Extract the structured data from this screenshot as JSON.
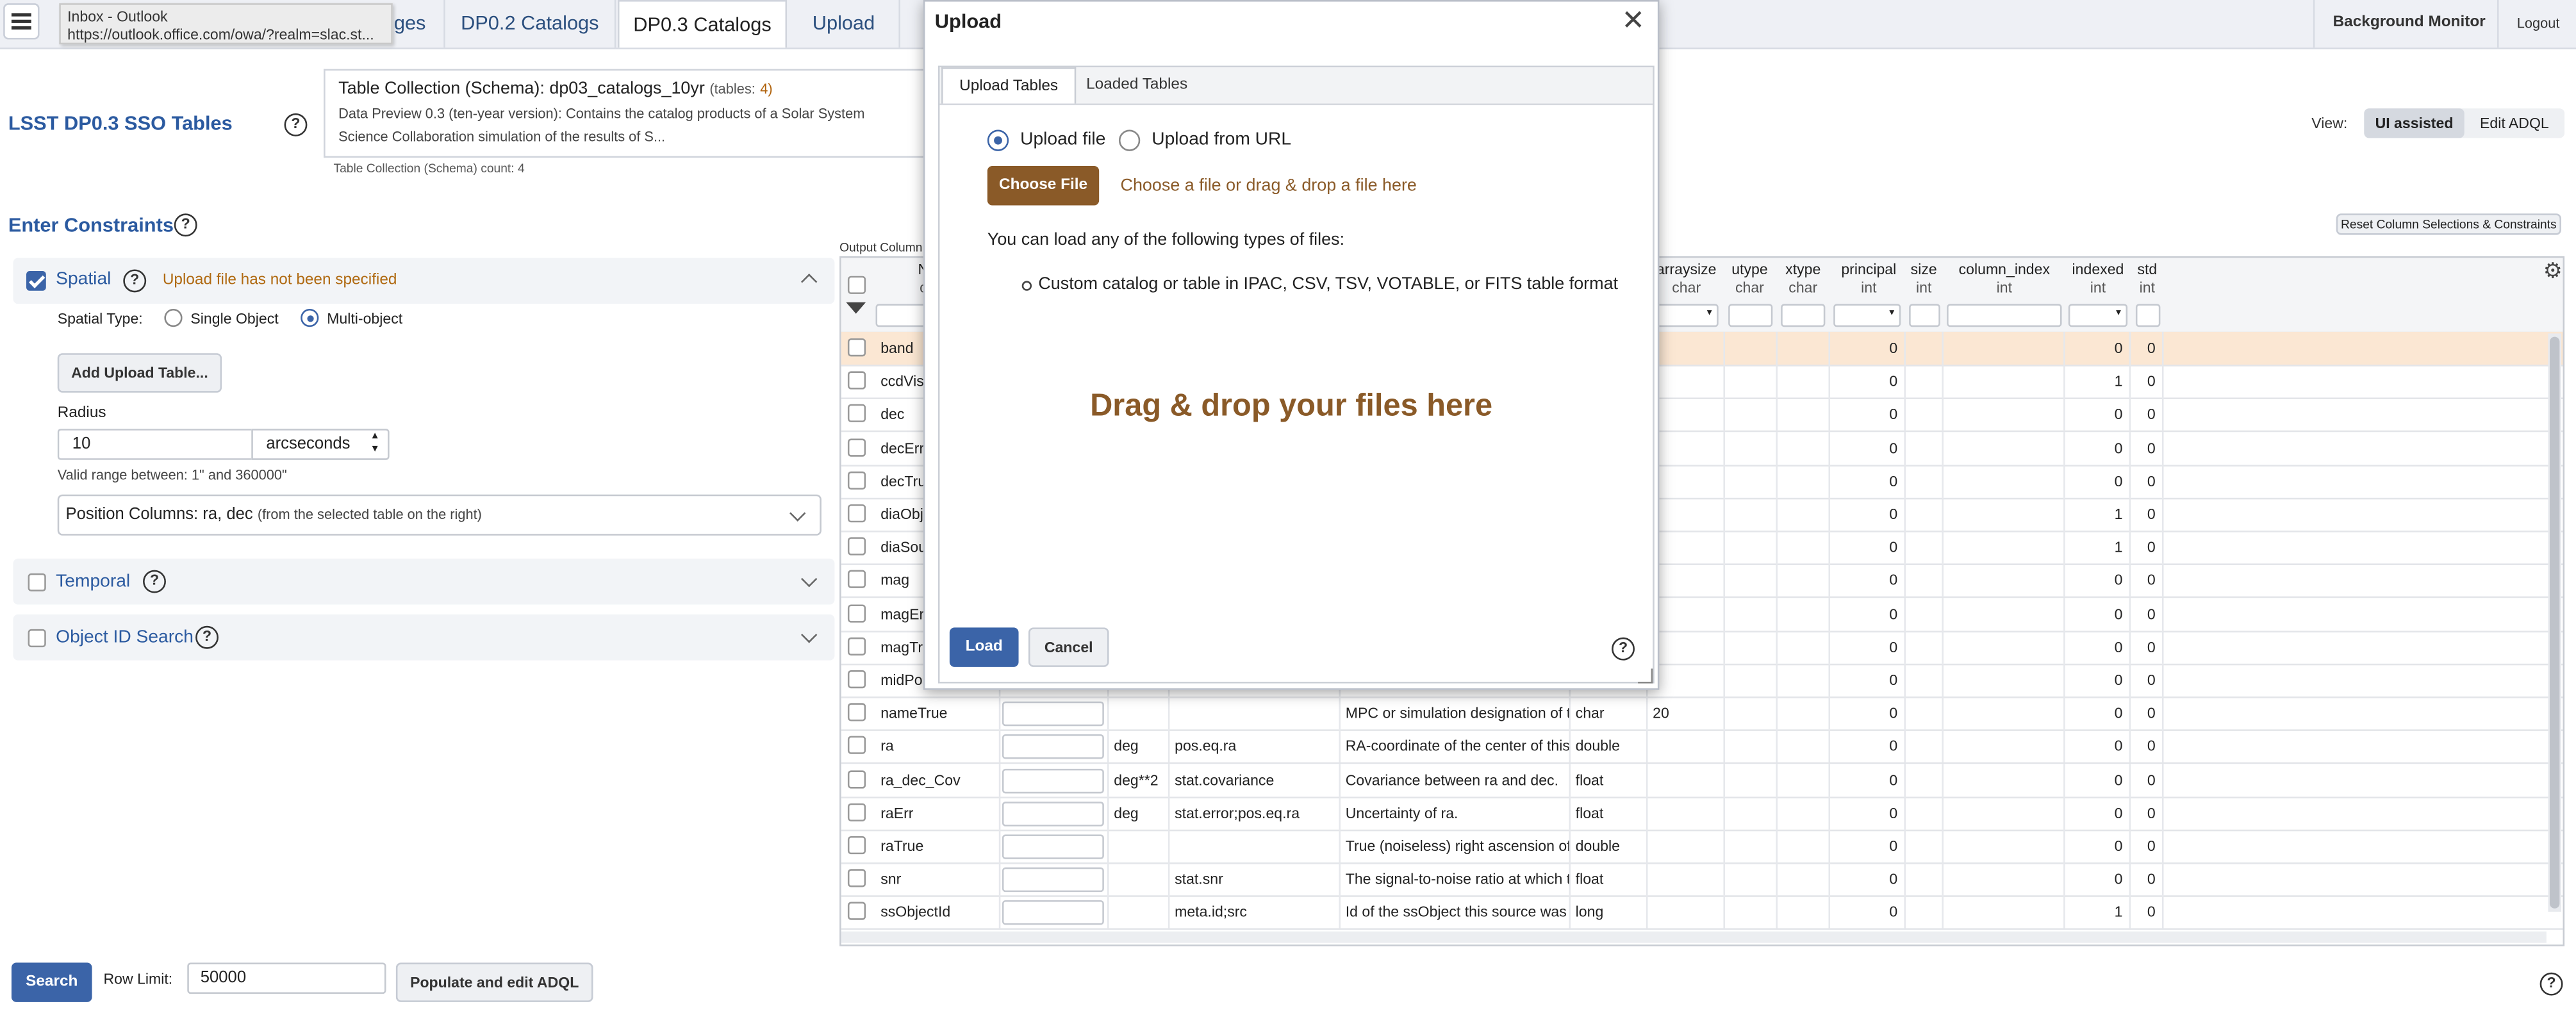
{
  "topbar": {
    "tabs": [
      {
        "label": "ges"
      },
      {
        "label": "DP0.2 Catalogs"
      },
      {
        "label": "DP0.3 Catalogs"
      },
      {
        "label": "Upload"
      }
    ],
    "background_monitor": "Background Monitor",
    "logout": "Logout",
    "tooltip": {
      "title": "Inbox - Outlook",
      "url": "https://outlook.office.com/owa/?realm=slac.st..."
    }
  },
  "header": {
    "title": "LSST DP0.3 SSO Tables",
    "collection_label": "Table Collection (Schema):",
    "collection_value": "dp03_catalogs_10yr",
    "tables_label": "(tables:",
    "tables_count": "4)",
    "description_1": "Data Preview 0.3 (ten-year version): Contains the catalog products of a Solar System",
    "description_2": "Science Collaboration simulation of the results of S...",
    "collection_count": "Table Collection (Schema) count: 4",
    "view_label": "View:",
    "view_ui": "UI assisted",
    "view_adql": "Edit ADQL"
  },
  "constraints": {
    "title": "Enter Constraints",
    "reset": "Reset Column Selections & Constraints",
    "output_columns": "Output Column",
    "spatial": {
      "label": "Spatial",
      "warning": "Upload file has not been specified",
      "type_label": "Spatial Type:",
      "single": "Single Object",
      "multi": "Multi-object",
      "add_upload": "Add Upload Table...",
      "radius_label": "Radius",
      "radius_value": "10",
      "radius_unit": "arcseconds",
      "valid_range": "Valid range between: 1\" and 360000\"",
      "position_label": "Position Columns:",
      "position_value": "ra, dec",
      "position_note": "(from the selected table on the right)"
    },
    "temporal": "Temporal",
    "object_id": "Object ID Search"
  },
  "bottom": {
    "search": "Search",
    "row_limit_label": "Row Limit:",
    "row_limit_value": "50000",
    "populate": "Populate and edit ADQL"
  },
  "grid": {
    "headers": [
      {
        "name": "N",
        "type": "c"
      },
      {
        "name": "arraysize",
        "type": "char"
      },
      {
        "name": "utype",
        "type": "char"
      },
      {
        "name": "xtype",
        "type": "char"
      },
      {
        "name": "principal",
        "type": "int"
      },
      {
        "name": "size",
        "type": "int"
      },
      {
        "name": "column_index",
        "type": "int"
      },
      {
        "name": "indexed",
        "type": "int"
      },
      {
        "name": "std",
        "type": "int"
      }
    ],
    "rows": [
      {
        "name": "band",
        "unit": "",
        "ucd": "",
        "desc": "",
        "dtype": "",
        "arraysize": "",
        "principal": "0",
        "indexed": "0",
        "std": "0"
      },
      {
        "name": "ccdVisit",
        "unit": "",
        "ucd": "",
        "desc": "",
        "dtype": "",
        "arraysize": "",
        "principal": "0",
        "indexed": "1",
        "std": "0"
      },
      {
        "name": "dec",
        "unit": "",
        "ucd": "",
        "desc": "",
        "dtype": "",
        "arraysize": "",
        "principal": "0",
        "indexed": "0",
        "std": "0"
      },
      {
        "name": "decErr",
        "unit": "",
        "ucd": "",
        "desc": "",
        "dtype": "",
        "arraysize": "",
        "principal": "0",
        "indexed": "0",
        "std": "0"
      },
      {
        "name": "decTrue",
        "unit": "",
        "ucd": "",
        "desc": "",
        "dtype": "",
        "arraysize": "",
        "principal": "0",
        "indexed": "0",
        "std": "0"
      },
      {
        "name": "diaObje",
        "unit": "",
        "ucd": "",
        "desc": "",
        "dtype": "",
        "arraysize": "",
        "principal": "0",
        "indexed": "1",
        "std": "0"
      },
      {
        "name": "diaSour",
        "unit": "",
        "ucd": "",
        "desc": "",
        "dtype": "",
        "arraysize": "",
        "principal": "0",
        "indexed": "1",
        "std": "0"
      },
      {
        "name": "mag",
        "unit": "",
        "ucd": "",
        "desc": "",
        "dtype": "",
        "arraysize": "",
        "principal": "0",
        "indexed": "0",
        "std": "0"
      },
      {
        "name": "magErr",
        "unit": "",
        "ucd": "",
        "desc": "",
        "dtype": "",
        "arraysize": "",
        "principal": "0",
        "indexed": "0",
        "std": "0"
      },
      {
        "name": "magTru",
        "unit": "",
        "ucd": "",
        "desc": "",
        "dtype": "",
        "arraysize": "",
        "principal": "0",
        "indexed": "0",
        "std": "0"
      },
      {
        "name": "midPoi",
        "unit": "",
        "ucd": "",
        "desc": "",
        "dtype": "",
        "arraysize": "",
        "principal": "0",
        "indexed": "0",
        "std": "0"
      },
      {
        "name": "nameTrue",
        "unit": "",
        "ucd": "",
        "desc": "MPC or simulation designation of th",
        "dtype": "char",
        "arraysize": "20",
        "principal": "0",
        "indexed": "0",
        "std": "0"
      },
      {
        "name": "ra",
        "unit": "deg",
        "ucd": "pos.eq.ra",
        "desc": "RA-coordinate of the center of this d",
        "dtype": "double",
        "arraysize": "",
        "principal": "0",
        "indexed": "0",
        "std": "0"
      },
      {
        "name": "ra_dec_Cov",
        "unit": "deg**2",
        "ucd": "stat.covariance",
        "desc": "Covariance between ra and dec.",
        "dtype": "float",
        "arraysize": "",
        "principal": "0",
        "indexed": "0",
        "std": "0"
      },
      {
        "name": "raErr",
        "unit": "deg",
        "ucd": "stat.error;pos.eq.ra",
        "desc": "Uncertainty of ra.",
        "dtype": "float",
        "arraysize": "",
        "principal": "0",
        "indexed": "0",
        "std": "0"
      },
      {
        "name": "raTrue",
        "unit": "",
        "ucd": "",
        "desc": "True (noiseless) right ascension of t",
        "dtype": "double",
        "arraysize": "",
        "principal": "0",
        "indexed": "0",
        "std": "0"
      },
      {
        "name": "snr",
        "unit": "",
        "ucd": "stat.snr",
        "desc": "The signal-to-noise ratio at which th",
        "dtype": "float",
        "arraysize": "",
        "principal": "0",
        "indexed": "0",
        "std": "0"
      },
      {
        "name": "ssObjectId",
        "unit": "",
        "ucd": "meta.id;src",
        "desc": "Id of the ssObject this source was a",
        "dtype": "long",
        "arraysize": "",
        "principal": "0",
        "indexed": "1",
        "std": "0"
      }
    ]
  },
  "modal": {
    "title": "Upload",
    "tab_upload": "Upload Tables",
    "tab_loaded": "Loaded Tables",
    "upload_file": "Upload file",
    "upload_url": "Upload from URL",
    "choose_file": "Choose File",
    "choose_hint": "Choose a file or drag & drop a file here",
    "types_intro": "You can load any of the following types of files:",
    "types_item": "Custom catalog or table in IPAC, CSV, TSV, VOTABLE, or FITS table format",
    "drag_drop": "Drag & drop your files here",
    "load": "Load",
    "cancel": "Cancel"
  },
  "colors": {
    "brand_blue": "#3b64a8",
    "link_blue": "#2b5aa0",
    "choose_brown": "#8a5a28",
    "drag_brown": "#8a5a28",
    "highlight_row": "#fbe7d3"
  }
}
